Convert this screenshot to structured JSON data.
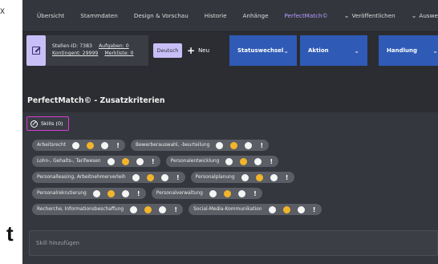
{
  "edge": {
    "top_glyph": "x",
    "bottom_glyph": "t"
  },
  "nav": {
    "items": [
      {
        "label": "Übersicht"
      },
      {
        "label": "Stammdaten"
      },
      {
        "label": "Design & Vorschau"
      },
      {
        "label": "Historie"
      },
      {
        "label": "Anhänge"
      },
      {
        "label": "PerfectMatch©"
      },
      {
        "label": "Veröffentlichen"
      },
      {
        "label": "Auswertungen"
      }
    ]
  },
  "toolbar": {
    "stellen_id": "Stellen-ID: 7383",
    "kontingent": "Kontingent: 29999",
    "aufgaben": "Aufgaben: 0",
    "merkliste": "Merkliste: 0",
    "language": "Deutsch",
    "new_label": "Neu",
    "statuswechsel": "Statuswechsel",
    "aktion": "Aktion",
    "handlung": "Handlung"
  },
  "section": {
    "title": "PerfectMatch© - Zusatzkriterien"
  },
  "skills": {
    "badge": "Skills (0)",
    "rows": [
      [
        {
          "label": "Arbeitsrecht"
        },
        {
          "label": "Bewerberauswahl, -beurteilung"
        }
      ],
      [
        {
          "label": "Lohn-, Gehalts-, Tarifwesen"
        },
        {
          "label": "Personalentwicklung"
        }
      ],
      [
        {
          "label": "Personalleasing, Arbeitnehmerverleih"
        },
        {
          "label": "Personalplanung"
        }
      ],
      [
        {
          "label": "Personalrekrutierung"
        },
        {
          "label": "Personalverwaltung"
        }
      ],
      [
        {
          "label": "Recherche, Informationsbeschaffung"
        },
        {
          "label": "Social-Media-Kommunikation"
        }
      ]
    ],
    "input_placeholder": "Skill hinzufügen"
  },
  "colors": {
    "accent": "#b79cff",
    "highlight_border": "#d63cd6",
    "action_blue": "#2f5bb6",
    "rating_yellow": "#f2b52a"
  }
}
